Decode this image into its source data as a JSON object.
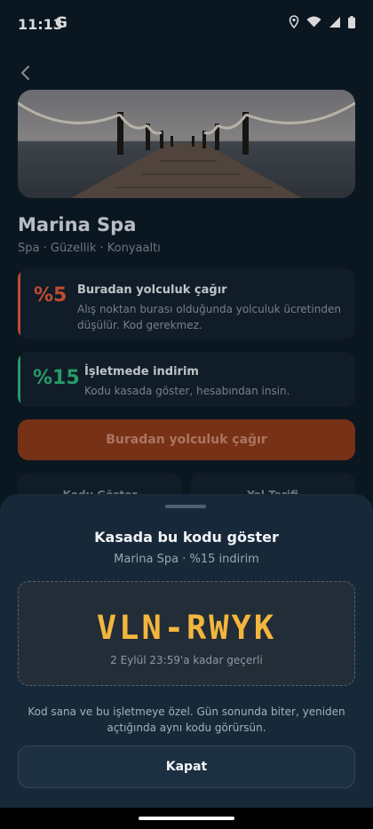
{
  "status": {
    "time": "11:13",
    "g_label": "G"
  },
  "place": {
    "name": "Marina Spa",
    "subtitle": "Spa · Güzellik · Konyaaltı"
  },
  "offers": [
    {
      "pct": "%5",
      "title": "Buradan yolculuk çağır",
      "desc": "Alış noktan burası olduğunda yolculuk ücretinden düşülür. Kod gerekmez.",
      "color": "#e05a3a"
    },
    {
      "pct": "%15",
      "title": "İşletmede indirim",
      "desc": "Kodu kasada göster, hesabından insin.",
      "color": "#2fb57a"
    }
  ],
  "actions": {
    "ride_label": "Buradan yolculuk çağır",
    "show_code_label": "Kodu Göster",
    "directions_label": "Yol Tarifi"
  },
  "sheet": {
    "title": "Kasada bu kodu göster",
    "subtitle": "Marina Spa · %15 indirim",
    "code": "VLN-RWYK",
    "valid_until": "2 Eylül 23:59'a kadar geçerli",
    "note": "Kod sana ve bu işletmeye özel. Gün sonunda biter, yeniden açtığında aynı kodu görürsün.",
    "close_label": "Kapat"
  },
  "colors": {
    "accent_code": "#f3b63d",
    "ride_button": "#8c3a1c",
    "sheet_bg": "#172939"
  }
}
